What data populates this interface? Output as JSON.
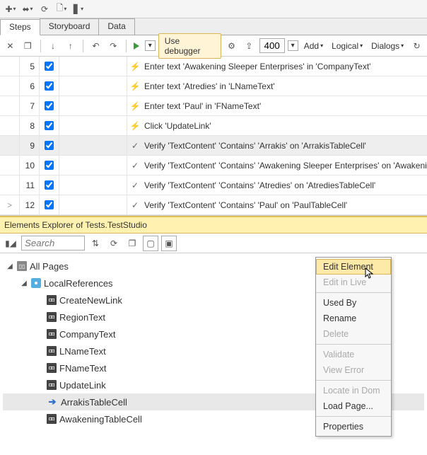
{
  "topToolbar": {},
  "tabs": [
    {
      "label": "Steps",
      "active": true
    },
    {
      "label": "Storyboard",
      "active": false
    },
    {
      "label": "Data",
      "active": false
    }
  ],
  "stepsToolbar": {
    "useDebugger": "Use debugger",
    "delay": "400",
    "add": "Add",
    "logical": "Logical",
    "dialogs": "Dialogs"
  },
  "steps": [
    {
      "n": "5",
      "icon": "bolt",
      "text": "Enter text 'Awakening Sleeper Enterprises' in 'CompanyText'",
      "sel": false
    },
    {
      "n": "6",
      "icon": "bolt",
      "text": "Enter text 'Atredies' in 'LNameText'",
      "sel": false
    },
    {
      "n": "7",
      "icon": "bolt",
      "text": "Enter text 'Paul' in 'FNameText'",
      "sel": false
    },
    {
      "n": "8",
      "icon": "bolt",
      "text": "Click 'UpdateLink'",
      "sel": false
    },
    {
      "n": "9",
      "icon": "check",
      "text": "Verify 'TextContent' 'Contains' 'Arrakis' on 'ArrakisTableCell'",
      "sel": true
    },
    {
      "n": "10",
      "icon": "check",
      "text": "Verify 'TextContent' 'Contains' 'Awakening Sleeper Enterprises' on 'AwakeningTableC",
      "sel": false
    },
    {
      "n": "11",
      "icon": "check",
      "text": "Verify 'TextContent' 'Contains' 'Atredies' on 'AtrediesTableCell'",
      "sel": false
    },
    {
      "n": "12",
      "icon": "check",
      "text": "Verify 'TextContent' 'Contains' 'Paul' on 'PaulTableCell'",
      "sel": false
    }
  ],
  "lastRowGutter": ">",
  "elementsHeader": "Elements Explorer of Tests.TestStudio",
  "searchPlaceholder": "Search",
  "tree": {
    "root": "All Pages",
    "page": "LocalReferences",
    "items": [
      {
        "label": "CreateNewLink",
        "sel": false,
        "type": "field"
      },
      {
        "label": "RegionText",
        "sel": false,
        "type": "field"
      },
      {
        "label": "CompanyText",
        "sel": false,
        "type": "field"
      },
      {
        "label": "LNameText",
        "sel": false,
        "type": "field"
      },
      {
        "label": "FNameText",
        "sel": false,
        "type": "field"
      },
      {
        "label": "UpdateLink",
        "sel": false,
        "type": "field"
      },
      {
        "label": "ArrakisTableCell",
        "sel": true,
        "type": "sel"
      },
      {
        "label": "AwakeningTableCell",
        "sel": false,
        "type": "field"
      }
    ]
  },
  "contextMenu": [
    {
      "label": "Edit Element",
      "state": "hover"
    },
    {
      "label": "Edit in Live",
      "state": "disabled"
    },
    {
      "type": "sep"
    },
    {
      "label": "Used By",
      "state": "normal"
    },
    {
      "label": "Rename",
      "state": "normal"
    },
    {
      "label": "Delete",
      "state": "disabled"
    },
    {
      "type": "sep"
    },
    {
      "label": "Validate",
      "state": "disabled"
    },
    {
      "label": "View Error",
      "state": "disabled"
    },
    {
      "type": "sep"
    },
    {
      "label": "Locate in Dom",
      "state": "disabled"
    },
    {
      "label": "Load Page...",
      "state": "normal"
    },
    {
      "type": "sep"
    },
    {
      "label": "Properties",
      "state": "normal"
    }
  ]
}
